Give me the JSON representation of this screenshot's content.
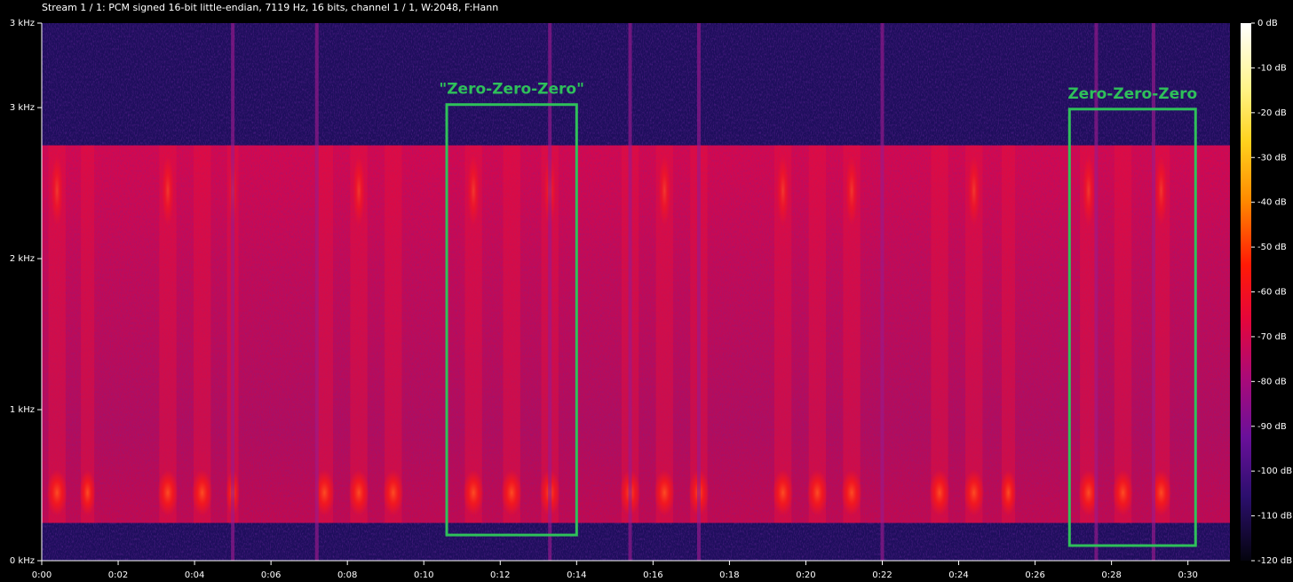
{
  "header": {
    "title": "Stream 1 / 1: PCM signed 16-bit little-endian, 7119 Hz, 16 bits, channel 1 / 1, W:2048, F:Hann"
  },
  "chart_data": {
    "type": "heatmap",
    "title": "",
    "xlabel": "",
    "ylabel": "",
    "x_unit": "seconds",
    "y_unit": "Hz",
    "xlim": [
      0,
      31.1
    ],
    "ylim": [
      0,
      3559.5
    ],
    "x_ticks": [
      {
        "value": 0,
        "label": "0:00"
      },
      {
        "value": 2,
        "label": "0:02"
      },
      {
        "value": 4,
        "label": "0:04"
      },
      {
        "value": 6,
        "label": "0:06"
      },
      {
        "value": 8,
        "label": "0:08"
      },
      {
        "value": 10,
        "label": "0:10"
      },
      {
        "value": 12,
        "label": "0:12"
      },
      {
        "value": 14,
        "label": "0:14"
      },
      {
        "value": 16,
        "label": "0:16"
      },
      {
        "value": 18,
        "label": "0:18"
      },
      {
        "value": 20,
        "label": "0:20"
      },
      {
        "value": 22,
        "label": "0:22"
      },
      {
        "value": 24,
        "label": "0:24"
      },
      {
        "value": 26,
        "label": "0:26"
      },
      {
        "value": 28,
        "label": "0:28"
      },
      {
        "value": 30,
        "label": "0:30"
      }
    ],
    "y_ticks": [
      {
        "value": 0,
        "label": "0 kHz"
      },
      {
        "value": 1000,
        "label": "1 kHz"
      },
      {
        "value": 2000,
        "label": "2 kHz"
      },
      {
        "value": 3000,
        "label": "3 kHz"
      },
      {
        "value": 3559.5,
        "label": "3 kHz"
      }
    ],
    "colorbar": {
      "unit": "dB",
      "range": [
        -120,
        0
      ],
      "ticks": [
        {
          "value": 0,
          "label": "0 dB"
        },
        {
          "value": -10,
          "label": "-10 dB"
        },
        {
          "value": -20,
          "label": "-20 dB"
        },
        {
          "value": -30,
          "label": "-30 dB"
        },
        {
          "value": -40,
          "label": "-40 dB"
        },
        {
          "value": -50,
          "label": "-50 dB"
        },
        {
          "value": -60,
          "label": "-60 dB"
        },
        {
          "value": -70,
          "label": "-70 dB"
        },
        {
          "value": -80,
          "label": "-80 dB"
        },
        {
          "value": -90,
          "label": "-90 dB"
        },
        {
          "value": -100,
          "label": "-100 dB"
        },
        {
          "value": -110,
          "label": "-110 dB"
        },
        {
          "value": -120,
          "label": "-120 dB"
        }
      ]
    },
    "band": {
      "low_hz": 250,
      "high_hz": 2750,
      "level_db": -70
    },
    "bursts": [
      {
        "t": 0.4,
        "w": 0.45
      },
      {
        "t": 1.2,
        "w": 0.35
      },
      {
        "t": 3.3,
        "w": 0.45
      },
      {
        "t": 4.2,
        "w": 0.45
      },
      {
        "t": 5.0,
        "w": 0.3
      },
      {
        "t": 7.4,
        "w": 0.45
      },
      {
        "t": 8.3,
        "w": 0.45
      },
      {
        "t": 9.2,
        "w": 0.45
      },
      {
        "t": 11.3,
        "w": 0.45
      },
      {
        "t": 12.3,
        "w": 0.45
      },
      {
        "t": 13.3,
        "w": 0.45
      },
      {
        "t": 15.4,
        "w": 0.45
      },
      {
        "t": 16.3,
        "w": 0.45
      },
      {
        "t": 17.2,
        "w": 0.45
      },
      {
        "t": 19.4,
        "w": 0.45
      },
      {
        "t": 20.3,
        "w": 0.45
      },
      {
        "t": 21.2,
        "w": 0.45
      },
      {
        "t": 23.5,
        "w": 0.45
      },
      {
        "t": 24.4,
        "w": 0.45
      },
      {
        "t": 25.3,
        "w": 0.35
      },
      {
        "t": 27.4,
        "w": 0.45
      },
      {
        "t": 28.3,
        "w": 0.45
      },
      {
        "t": 29.3,
        "w": 0.45
      }
    ],
    "impulses": [
      5.0,
      7.2,
      13.3,
      15.4,
      17.2,
      22.0,
      27.6,
      29.1
    ],
    "annotations": [
      {
        "label": "\"Zero-Zero-Zero\"",
        "t_start": 10.6,
        "t_end": 14.0,
        "f_low": 170,
        "f_high": 3020,
        "color": "#2fc05a"
      },
      {
        "label": "Zero-Zero-Zero",
        "t_start": 26.9,
        "t_end": 30.2,
        "f_low": 100,
        "f_high": 2990,
        "color": "#2fc05a"
      }
    ]
  }
}
